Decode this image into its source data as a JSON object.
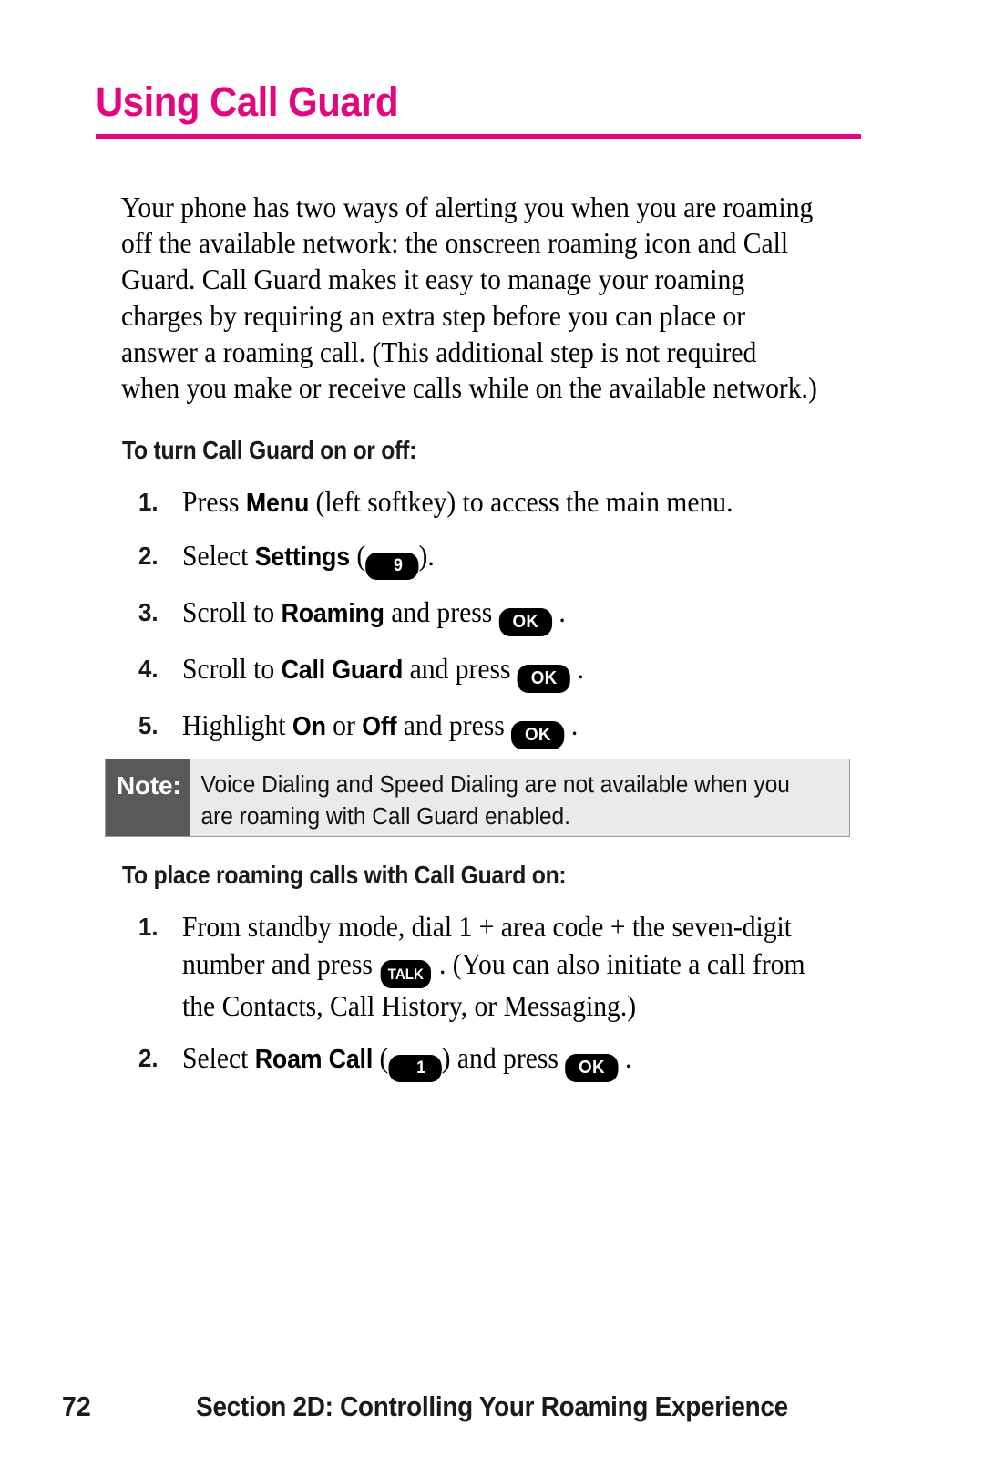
{
  "document": {
    "title": "Using Call Guard",
    "accent_color": "#e2067f",
    "intro_paragraph": "Your phone has two ways of alerting you when you are roaming off the available network: the onscreen roaming icon and Call Guard. Call Guard makes it easy to manage your roaming charges by requiring an extra step before you can place or answer a roaming call. (This additional step is not required when you make or receive calls while on the available network.)"
  },
  "section_one": {
    "heading": "To turn Call Guard on or off:",
    "steps": [
      {
        "number": "1.",
        "parts": [
          {
            "type": "text",
            "value": "Press "
          },
          {
            "type": "bold",
            "value": "Menu"
          },
          {
            "type": "text",
            "value": " (left softkey) to access the main menu."
          }
        ]
      },
      {
        "number": "2.",
        "parts": [
          {
            "type": "text",
            "value": "Select "
          },
          {
            "type": "bold",
            "value": "Settings"
          },
          {
            "type": "text",
            "value": " ("
          },
          {
            "type": "key",
            "key_style": "digit",
            "value": "9",
            "icon": "key-9-icon"
          },
          {
            "type": "text",
            "value": ")."
          }
        ]
      },
      {
        "number": "3.",
        "parts": [
          {
            "type": "text",
            "value": "Scroll to "
          },
          {
            "type": "bold",
            "value": "Roaming"
          },
          {
            "type": "text",
            "value": " and press "
          },
          {
            "type": "key",
            "key_style": "ok",
            "value": "OK",
            "icon": "key-ok-icon"
          },
          {
            "type": "text",
            "value": " ."
          }
        ]
      },
      {
        "number": "4.",
        "parts": [
          {
            "type": "text",
            "value": "Scroll to "
          },
          {
            "type": "bold",
            "value": "Call Guard"
          },
          {
            "type": "text",
            "value": " and press "
          },
          {
            "type": "key",
            "key_style": "ok",
            "value": "OK",
            "icon": "key-ok-icon"
          },
          {
            "type": "text",
            "value": " ."
          }
        ]
      },
      {
        "number": "5.",
        "parts": [
          {
            "type": "text",
            "value": "Highlight "
          },
          {
            "type": "bold",
            "value": "On"
          },
          {
            "type": "text",
            "value": " or "
          },
          {
            "type": "bold",
            "value": "Off"
          },
          {
            "type": "text",
            "value": " and press "
          },
          {
            "type": "key",
            "key_style": "ok",
            "value": "OK",
            "icon": "key-ok-icon"
          },
          {
            "type": "text",
            "value": " ."
          }
        ]
      }
    ]
  },
  "note": {
    "label": "Note:",
    "text": "Voice Dialing and Speed Dialing are not available when you are roaming with Call Guard enabled.",
    "label_background": "#595959",
    "body_background": "#eaeaea"
  },
  "section_two": {
    "heading": "To place roaming calls with Call Guard on:",
    "steps": [
      {
        "number": "1.",
        "parts": [
          {
            "type": "text",
            "value": "From standby mode, dial 1 + area code + the seven-digit number and press "
          },
          {
            "type": "key",
            "key_style": "talk",
            "value": "TALK",
            "icon": "key-talk-icon"
          },
          {
            "type": "text",
            "value": " . (You can also initiate a call from the Contacts, Call History, or Messaging.)"
          }
        ]
      },
      {
        "number": "2.",
        "parts": [
          {
            "type": "text",
            "value": "Select "
          },
          {
            "type": "bold",
            "value": "Roam Call"
          },
          {
            "type": "text",
            "value": " ("
          },
          {
            "type": "key",
            "key_style": "digit",
            "value": "1",
            "icon": "key-1-icon"
          },
          {
            "type": "text",
            "value": ") and press "
          },
          {
            "type": "key",
            "key_style": "ok",
            "value": "OK",
            "icon": "key-ok-icon"
          },
          {
            "type": "text",
            "value": " ."
          }
        ]
      }
    ]
  },
  "footer": {
    "page_number": "72",
    "section_label": "Section 2D: Controlling Your Roaming Experience"
  }
}
